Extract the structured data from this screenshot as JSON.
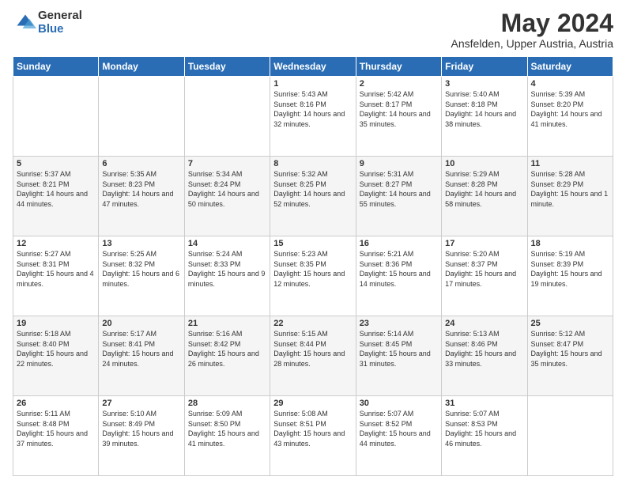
{
  "header": {
    "logo_general": "General",
    "logo_blue": "Blue",
    "title": "May 2024",
    "location": "Ansfelden, Upper Austria, Austria"
  },
  "weekdays": [
    "Sunday",
    "Monday",
    "Tuesday",
    "Wednesday",
    "Thursday",
    "Friday",
    "Saturday"
  ],
  "weeks": [
    [
      {
        "day": "",
        "sunrise": "",
        "sunset": "",
        "daylight": ""
      },
      {
        "day": "",
        "sunrise": "",
        "sunset": "",
        "daylight": ""
      },
      {
        "day": "",
        "sunrise": "",
        "sunset": "",
        "daylight": ""
      },
      {
        "day": "1",
        "sunrise": "5:43 AM",
        "sunset": "8:16 PM",
        "daylight": "14 hours and 32 minutes."
      },
      {
        "day": "2",
        "sunrise": "5:42 AM",
        "sunset": "8:17 PM",
        "daylight": "14 hours and 35 minutes."
      },
      {
        "day": "3",
        "sunrise": "5:40 AM",
        "sunset": "8:18 PM",
        "daylight": "14 hours and 38 minutes."
      },
      {
        "day": "4",
        "sunrise": "5:39 AM",
        "sunset": "8:20 PM",
        "daylight": "14 hours and 41 minutes."
      }
    ],
    [
      {
        "day": "5",
        "sunrise": "5:37 AM",
        "sunset": "8:21 PM",
        "daylight": "14 hours and 44 minutes."
      },
      {
        "day": "6",
        "sunrise": "5:35 AM",
        "sunset": "8:23 PM",
        "daylight": "14 hours and 47 minutes."
      },
      {
        "day": "7",
        "sunrise": "5:34 AM",
        "sunset": "8:24 PM",
        "daylight": "14 hours and 50 minutes."
      },
      {
        "day": "8",
        "sunrise": "5:32 AM",
        "sunset": "8:25 PM",
        "daylight": "14 hours and 52 minutes."
      },
      {
        "day": "9",
        "sunrise": "5:31 AM",
        "sunset": "8:27 PM",
        "daylight": "14 hours and 55 minutes."
      },
      {
        "day": "10",
        "sunrise": "5:29 AM",
        "sunset": "8:28 PM",
        "daylight": "14 hours and 58 minutes."
      },
      {
        "day": "11",
        "sunrise": "5:28 AM",
        "sunset": "8:29 PM",
        "daylight": "15 hours and 1 minute."
      }
    ],
    [
      {
        "day": "12",
        "sunrise": "5:27 AM",
        "sunset": "8:31 PM",
        "daylight": "15 hours and 4 minutes."
      },
      {
        "day": "13",
        "sunrise": "5:25 AM",
        "sunset": "8:32 PM",
        "daylight": "15 hours and 6 minutes."
      },
      {
        "day": "14",
        "sunrise": "5:24 AM",
        "sunset": "8:33 PM",
        "daylight": "15 hours and 9 minutes."
      },
      {
        "day": "15",
        "sunrise": "5:23 AM",
        "sunset": "8:35 PM",
        "daylight": "15 hours and 12 minutes."
      },
      {
        "day": "16",
        "sunrise": "5:21 AM",
        "sunset": "8:36 PM",
        "daylight": "15 hours and 14 minutes."
      },
      {
        "day": "17",
        "sunrise": "5:20 AM",
        "sunset": "8:37 PM",
        "daylight": "15 hours and 17 minutes."
      },
      {
        "day": "18",
        "sunrise": "5:19 AM",
        "sunset": "8:39 PM",
        "daylight": "15 hours and 19 minutes."
      }
    ],
    [
      {
        "day": "19",
        "sunrise": "5:18 AM",
        "sunset": "8:40 PM",
        "daylight": "15 hours and 22 minutes."
      },
      {
        "day": "20",
        "sunrise": "5:17 AM",
        "sunset": "8:41 PM",
        "daylight": "15 hours and 24 minutes."
      },
      {
        "day": "21",
        "sunrise": "5:16 AM",
        "sunset": "8:42 PM",
        "daylight": "15 hours and 26 minutes."
      },
      {
        "day": "22",
        "sunrise": "5:15 AM",
        "sunset": "8:44 PM",
        "daylight": "15 hours and 28 minutes."
      },
      {
        "day": "23",
        "sunrise": "5:14 AM",
        "sunset": "8:45 PM",
        "daylight": "15 hours and 31 minutes."
      },
      {
        "day": "24",
        "sunrise": "5:13 AM",
        "sunset": "8:46 PM",
        "daylight": "15 hours and 33 minutes."
      },
      {
        "day": "25",
        "sunrise": "5:12 AM",
        "sunset": "8:47 PM",
        "daylight": "15 hours and 35 minutes."
      }
    ],
    [
      {
        "day": "26",
        "sunrise": "5:11 AM",
        "sunset": "8:48 PM",
        "daylight": "15 hours and 37 minutes."
      },
      {
        "day": "27",
        "sunrise": "5:10 AM",
        "sunset": "8:49 PM",
        "daylight": "15 hours and 39 minutes."
      },
      {
        "day": "28",
        "sunrise": "5:09 AM",
        "sunset": "8:50 PM",
        "daylight": "15 hours and 41 minutes."
      },
      {
        "day": "29",
        "sunrise": "5:08 AM",
        "sunset": "8:51 PM",
        "daylight": "15 hours and 43 minutes."
      },
      {
        "day": "30",
        "sunrise": "5:07 AM",
        "sunset": "8:52 PM",
        "daylight": "15 hours and 44 minutes."
      },
      {
        "day": "31",
        "sunrise": "5:07 AM",
        "sunset": "8:53 PM",
        "daylight": "15 hours and 46 minutes."
      },
      {
        "day": "",
        "sunrise": "",
        "sunset": "",
        "daylight": ""
      }
    ]
  ]
}
